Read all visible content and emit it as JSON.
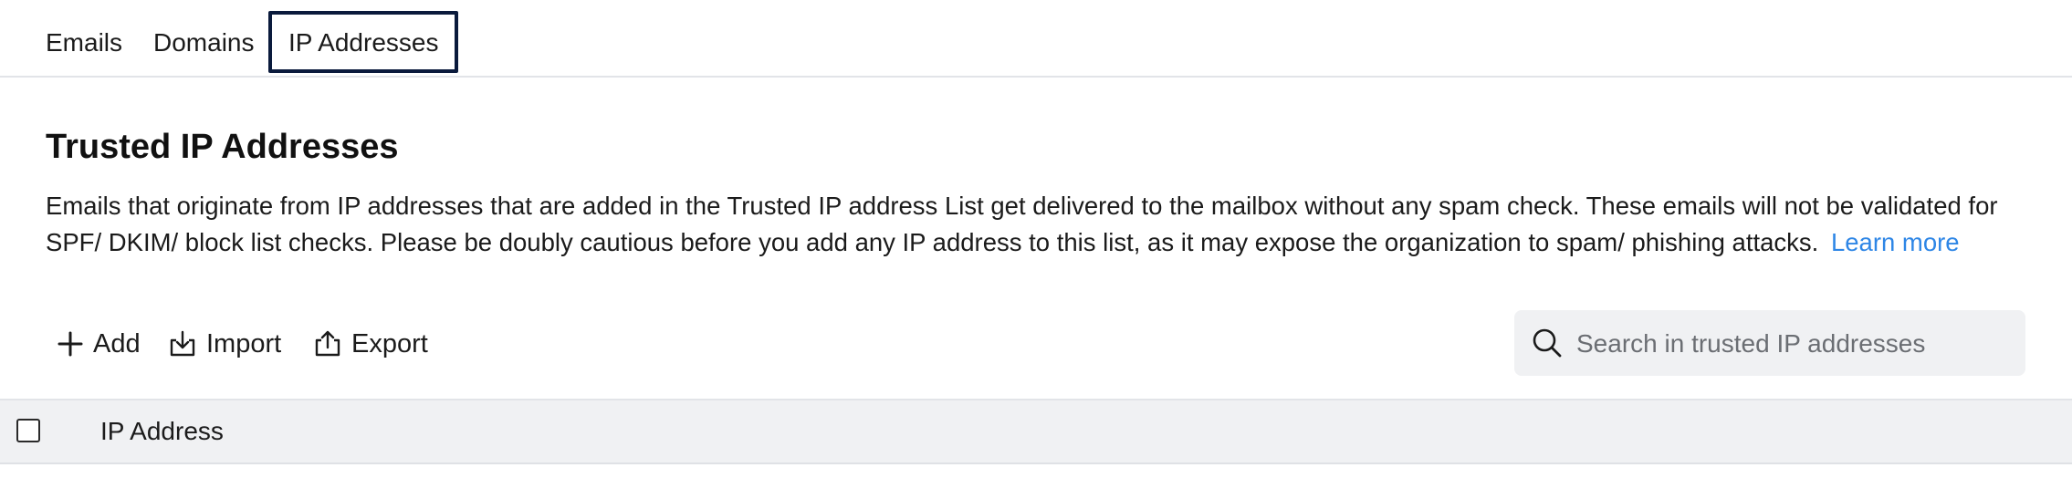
{
  "tabs": [
    {
      "label": "Emails"
    },
    {
      "label": "Domains"
    },
    {
      "label": "IP Addresses",
      "active": true
    }
  ],
  "section": {
    "title": "Trusted IP Addresses",
    "description": "Emails that originate from IP addresses that are added in the Trusted IP address List get delivered to the mailbox without any spam check. These emails will not be validated for SPF/ DKIM/ block list checks. Please be doubly cautious before you add any IP address to this list, as it may expose the organization to spam/ phishing attacks.",
    "learn_more": "Learn more"
  },
  "toolbar": {
    "add_label": "Add",
    "import_label": "Import",
    "export_label": "Export"
  },
  "search": {
    "placeholder": "Search in trusted IP addresses",
    "value": ""
  },
  "table": {
    "columns": [
      "IP Address"
    ],
    "rows": []
  },
  "colors": {
    "active_tab_border": "#0a1a3c",
    "link": "#2e86e6",
    "header_bg": "#f0f1f3"
  }
}
